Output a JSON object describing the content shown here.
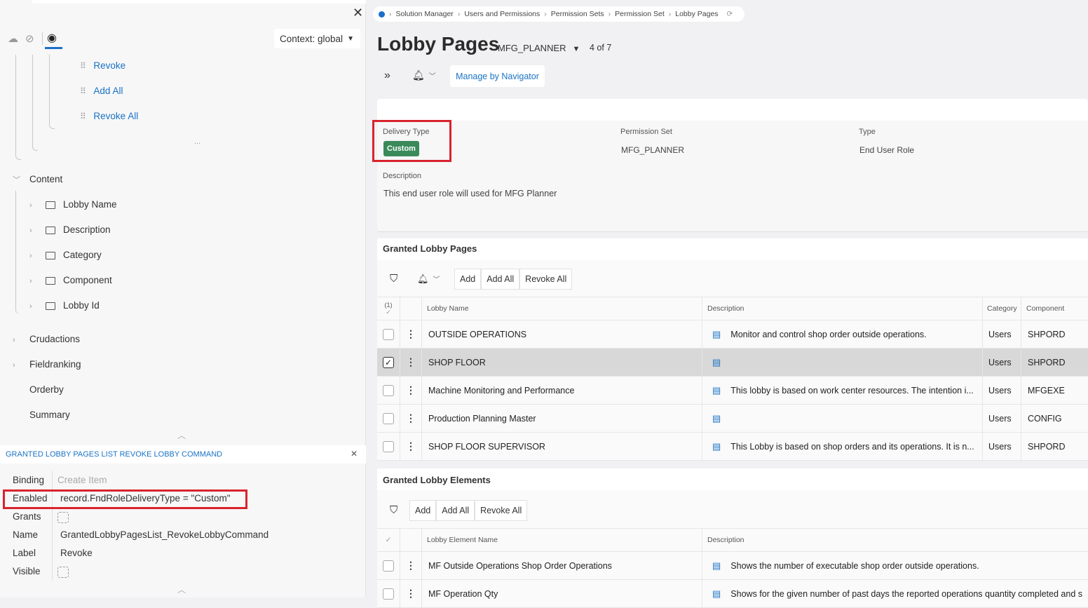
{
  "left_panel": {
    "context_label": "Context: global",
    "tree_commands": [
      "Revoke",
      "Add All",
      "Revoke All"
    ],
    "more": "...",
    "content_label": "Content",
    "content_children": [
      "Lobby Name",
      "Description",
      "Category",
      "Component",
      "Lobby Id"
    ],
    "other_nodes": [
      "Crudactions",
      "Fieldranking",
      "Orderby",
      "Summary"
    ]
  },
  "properties": {
    "title": "GRANTED LOBBY PAGES LIST REVOKE LOBBY COMMAND",
    "rows": [
      {
        "label": "Binding",
        "value": "Create Item"
      },
      {
        "label": "Enabled",
        "value": "record.FndRoleDeliveryType = \"Custom\""
      },
      {
        "label": "Grants",
        "value": ""
      },
      {
        "label": "Name",
        "value": "GrantedLobbyPagesList_RevokeLobbyCommand"
      },
      {
        "label": "Label",
        "value": "Revoke"
      },
      {
        "label": "Visible",
        "value": ""
      }
    ]
  },
  "breadcrumb": [
    "Solution Manager",
    "Users and Permissions",
    "Permission Sets",
    "Permission Set",
    "Lobby Pages"
  ],
  "header": {
    "title": "Lobby Pages",
    "record": "MFG_PLANNER",
    "counter": "4 of 7",
    "manage_button": "Manage by Navigator"
  },
  "details": {
    "delivery_type_label": "Delivery Type",
    "delivery_type": "Custom",
    "badge_color": "#3b8a5a",
    "permission_set_label": "Permission Set",
    "permission_set": "MFG_PLANNER",
    "type_label": "Type",
    "type": "End User Role",
    "description_label": "Description",
    "description": "This end user role will used for MFG Planner"
  },
  "lobby_pages": {
    "title": "Granted Lobby Pages",
    "buttons": [
      "Add",
      "Add All",
      "Revoke All"
    ],
    "selected_count": "(1)",
    "columns": [
      "Lobby Name",
      "Description",
      "Category",
      "Component"
    ],
    "rows": [
      {
        "name": "OUTSIDE OPERATIONS",
        "description": "Monitor and control shop order outside operations.",
        "category": "Users",
        "component": "SHPORD",
        "selected": false
      },
      {
        "name": "SHOP FLOOR",
        "description": "",
        "category": "Users",
        "component": "SHPORD",
        "selected": true
      },
      {
        "name": "Machine Monitoring and Performance",
        "description": "This lobby is based on work center resources. The intention i...",
        "category": "Users",
        "component": "MFGEXE",
        "selected": false
      },
      {
        "name": "Production Planning Master",
        "description": "",
        "category": "Users",
        "component": "CONFIG",
        "selected": false
      },
      {
        "name": "SHOP FLOOR SUPERVISOR",
        "description": "This Lobby is based on shop orders and its operations. It is n...",
        "category": "Users",
        "component": "SHPORD",
        "selected": false
      }
    ]
  },
  "lobby_elements": {
    "title": "Granted Lobby Elements",
    "buttons": [
      "Add",
      "Add All",
      "Revoke All"
    ],
    "columns": [
      "Lobby Element Name",
      "Description"
    ],
    "rows": [
      {
        "name": "MF Outside Operations Shop Order Operations",
        "description": "Shows the number of executable shop order outside operations."
      },
      {
        "name": "MF Operation Qty",
        "description": "Shows for the given number of past days the reported operations quantity completed and s"
      }
    ]
  }
}
